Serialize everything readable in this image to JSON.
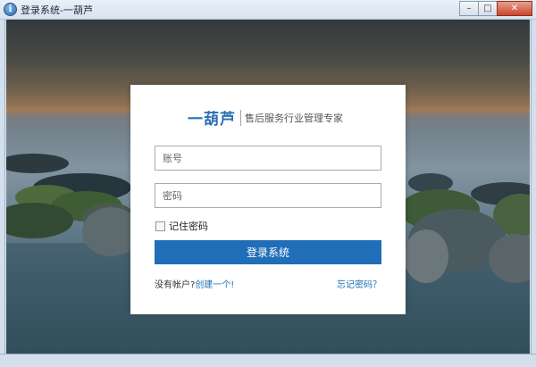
{
  "window": {
    "title": "登录系统-一葫芦",
    "app_icon_glyph": "i",
    "controls": {
      "minimize": "–",
      "maximize": "□",
      "close": "✕"
    }
  },
  "brand": {
    "logo": "一葫芦",
    "slogan": "售后服务行业管理专家"
  },
  "form": {
    "username_placeholder": "账号",
    "password_placeholder": "密码",
    "remember_label": "记住密码",
    "remember_checked": false,
    "login_button": "登录系统"
  },
  "footer": {
    "no_account": "没有帐户?",
    "create_link": "创建一个!",
    "forgot_link": "忘记密码？"
  },
  "colors": {
    "accent": "#1f6eb7"
  }
}
